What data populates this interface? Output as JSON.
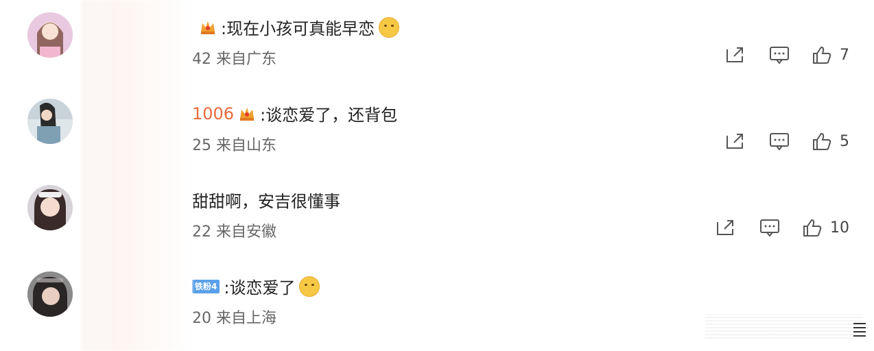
{
  "comments": [
    {
      "name_fragment": "",
      "text": ":现在小孩可真能早恋",
      "meta": "42 来自广东",
      "likes": "7",
      "has_crown": true,
      "emoji": "thinking-emoji"
    },
    {
      "name_fragment": "1006",
      "text": ":谈恋爱了，还背包",
      "meta": "25 来自山东",
      "likes": "5",
      "has_crown": true
    },
    {
      "name_fragment": "",
      "text": "甜甜啊，安吉很懂事",
      "meta": "22 来自安徽",
      "likes": "10"
    },
    {
      "name_fragment": "",
      "badge": "铁粉4",
      "text": ":谈恋爱了",
      "meta": "20 来自上海",
      "emoji": "smile-emoji"
    }
  ],
  "icons": {
    "share": "share-icon",
    "comment": "comment-icon",
    "like": "thumbs-up-icon"
  },
  "colors": {
    "name_orange": "#e86a3a",
    "badge_blue": "#5aa0e8",
    "icon_gray": "#555555"
  }
}
